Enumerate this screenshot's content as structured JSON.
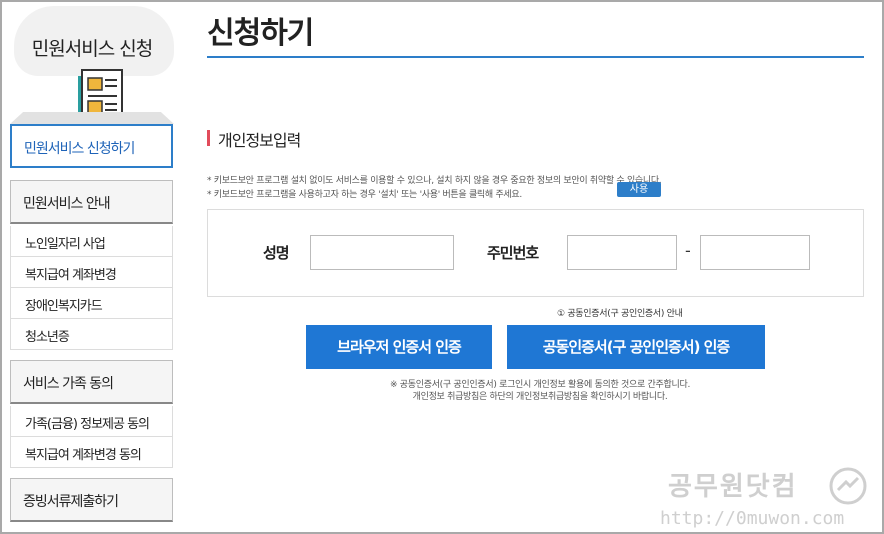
{
  "sidebar": {
    "title": "민원서비스 신청",
    "active_item": "민원서비스 신청하기",
    "sections": [
      {
        "label": "민원서비스 안내",
        "items": [
          "노인일자리 사업",
          "복지급여 계좌변경",
          "장애인복지카드",
          "청소년증"
        ]
      },
      {
        "label": "서비스 가족 동의",
        "items": [
          "가족(금융) 정보제공 동의",
          "복지급여 계좌변경 동의"
        ]
      },
      {
        "label": "증빙서류제출하기",
        "items": []
      }
    ]
  },
  "main": {
    "title": "신청하기",
    "section_title": "개인정보입력",
    "notes": [
      "* 키보드보안 프로그램 설치 없이도 서비스를 이용할 수 있으나, 설치 하지 않을 경우 중요한 정보의 보안이 취약할 수 있습니다.",
      "* 키보드보안 프로그램을 사용하고자 하는 경우 '설치' 또는 '사용' 버튼을 클릭해 주세요."
    ],
    "use_button": "사용",
    "form": {
      "name_label": "성명",
      "name_value": "",
      "rrn_label": "주민번호",
      "rrn_front_value": "",
      "rrn_separator": "-",
      "rrn_back_value": ""
    },
    "cert_help": "① 공동인증서(구 공인인증서) 안내",
    "browser_cert_button": "브라우저 인증서 인증",
    "joint_cert_button": "공동인증서(구 공인인증서) 인증",
    "disclaimer": [
      "※ 공동인증서(구 공인인증서) 로그인시 개인정보 활용에 동의한 것으로 간주합니다.",
      "개인정보 취급방침은 하단의 개인정보취급방침을 확인하시기 바랍니다."
    ]
  },
  "watermark": {
    "brand": "공무원닷컴",
    "url": "http://0muwon.com"
  },
  "colors": {
    "accent": "#2d7ec9",
    "button": "#1f77d4",
    "section_marker": "#e24c5b"
  }
}
